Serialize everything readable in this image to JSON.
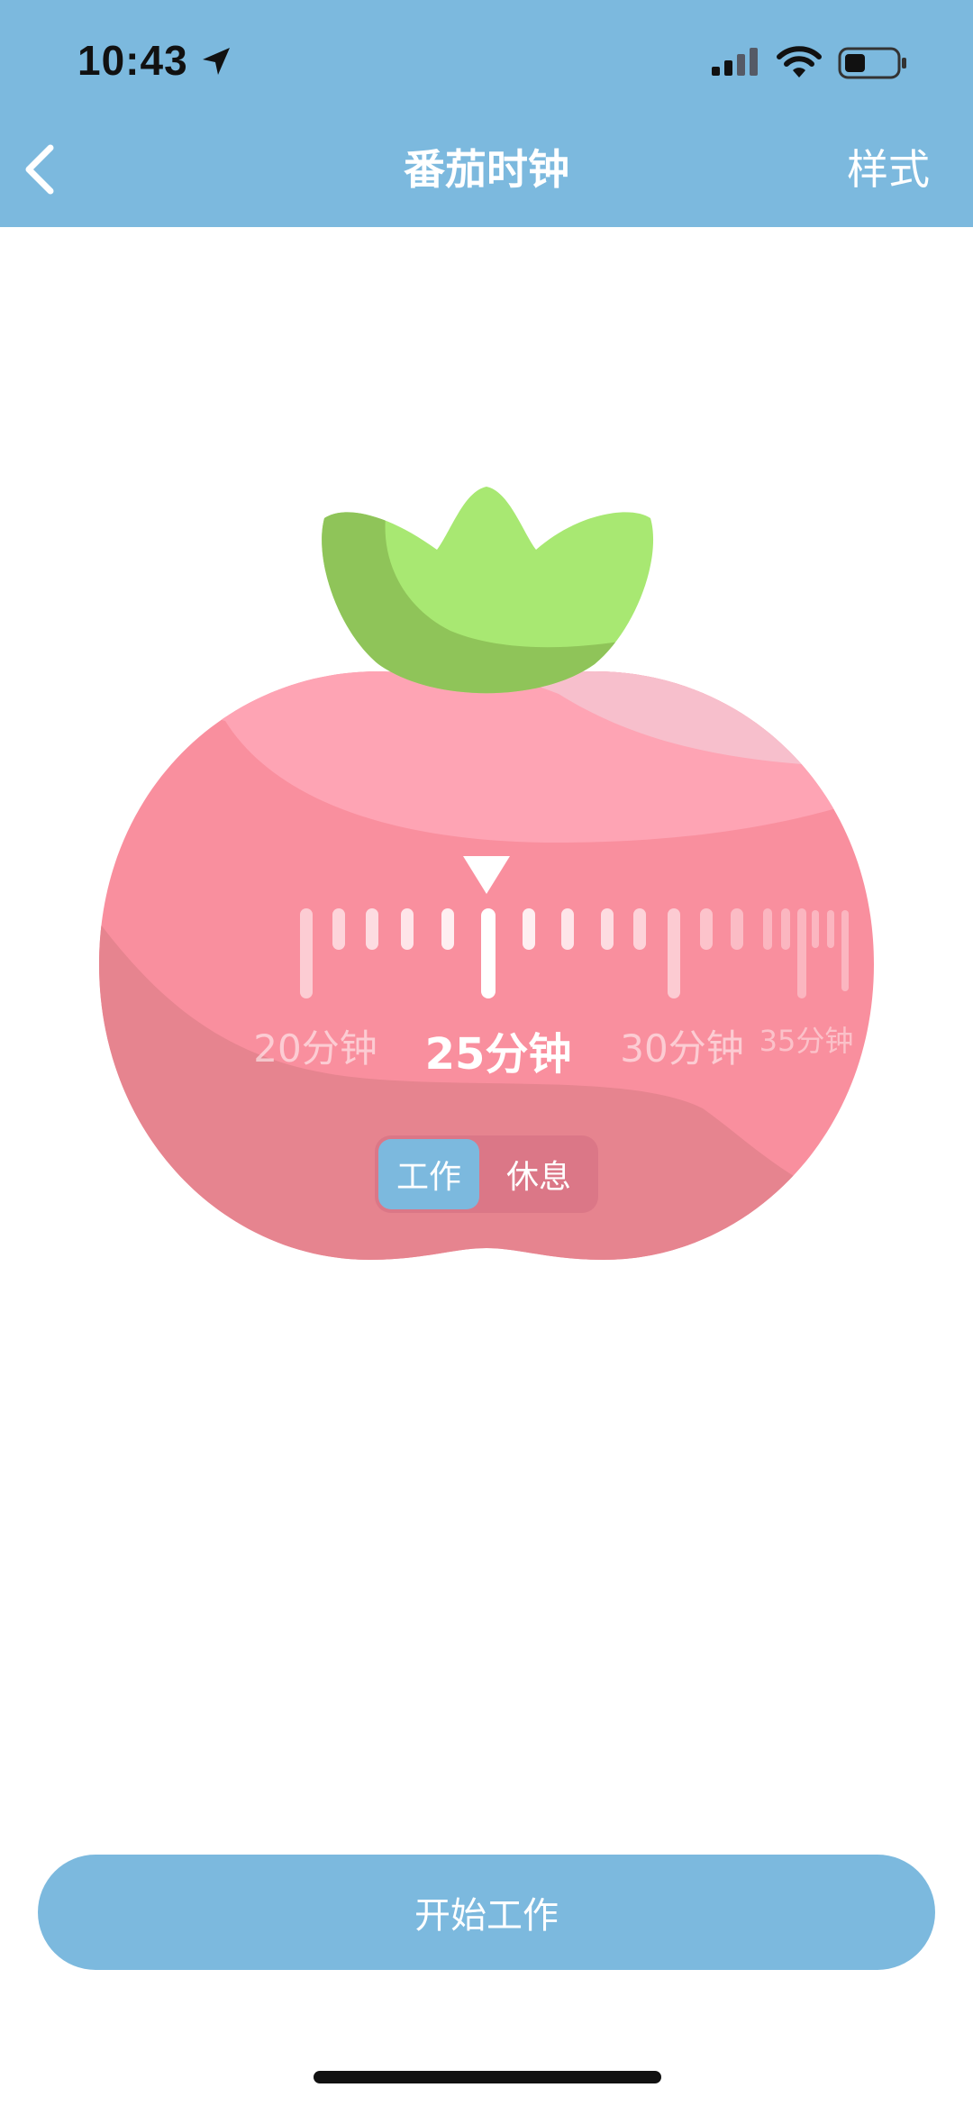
{
  "status_bar": {
    "time": "10:43"
  },
  "nav": {
    "title": "番茄时钟",
    "right_label": "样式"
  },
  "timer": {
    "labels": [
      "20分钟",
      "25分钟",
      "30分钟",
      "35分钟"
    ],
    "selected_minutes": 25
  },
  "mode_toggle": {
    "work": "工作",
    "rest": "休息",
    "selected": "工作"
  },
  "start_button": {
    "label": "开始工作"
  },
  "colors": {
    "primary_blue": "#7cb9de",
    "tomato_pink": "#f98f9e",
    "leaf_green": "#a8e872"
  }
}
